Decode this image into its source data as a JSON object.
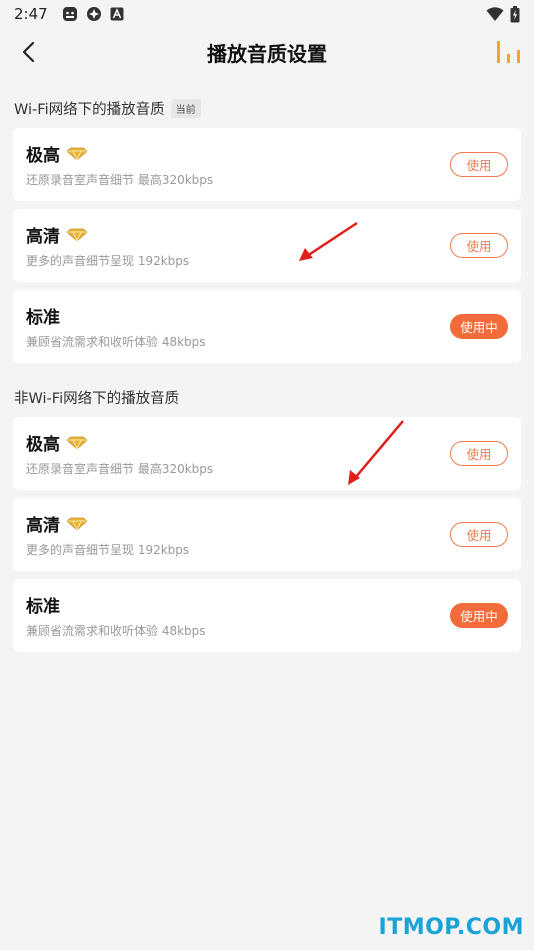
{
  "status_bar": {
    "time": "2:47",
    "icons_left": [
      "android-icon",
      "settings-icon",
      "a-icon"
    ],
    "icons_right": [
      "wifi-icon",
      "battery-icon"
    ]
  },
  "app_bar": {
    "title": "播放音质设置",
    "right_icon": "quality-bars-icon"
  },
  "sections": [
    {
      "header": "Wi-Fi网络下的播放音质",
      "tag": "当前",
      "items": [
        {
          "title": "极高",
          "desc": "还原录音室声音细节 最高320kbps",
          "button": "使用",
          "active": false,
          "vip": true
        },
        {
          "title": "高清",
          "desc": "更多的声音细节呈现 192kbps",
          "button": "使用",
          "active": false,
          "vip": true
        },
        {
          "title": "标准",
          "desc": "兼顾省流需求和收听体验 48kbps",
          "button": "使用中",
          "active": true,
          "vip": false
        }
      ]
    },
    {
      "header": "非Wi-Fi网络下的播放音质",
      "items": [
        {
          "title": "极高",
          "desc": "还原录音室声音细节 最高320kbps",
          "button": "使用",
          "active": false,
          "vip": true
        },
        {
          "title": "高清",
          "desc": "更多的声音细节呈现 192kbps",
          "button": "使用",
          "active": false,
          "vip": true
        },
        {
          "title": "标准",
          "desc": "兼顾省流需求和收听体验 48kbps",
          "button": "使用中",
          "active": true,
          "vip": false
        }
      ]
    }
  ],
  "watermark": "ITMOP.COM",
  "colors": {
    "accent": "#f26b3a",
    "accent_outline": "#f07a4f",
    "diamond": "#e8b53a",
    "arrow": "#e0201a",
    "watermark": "#1aa3d6",
    "title_icon": "#f5a623"
  }
}
